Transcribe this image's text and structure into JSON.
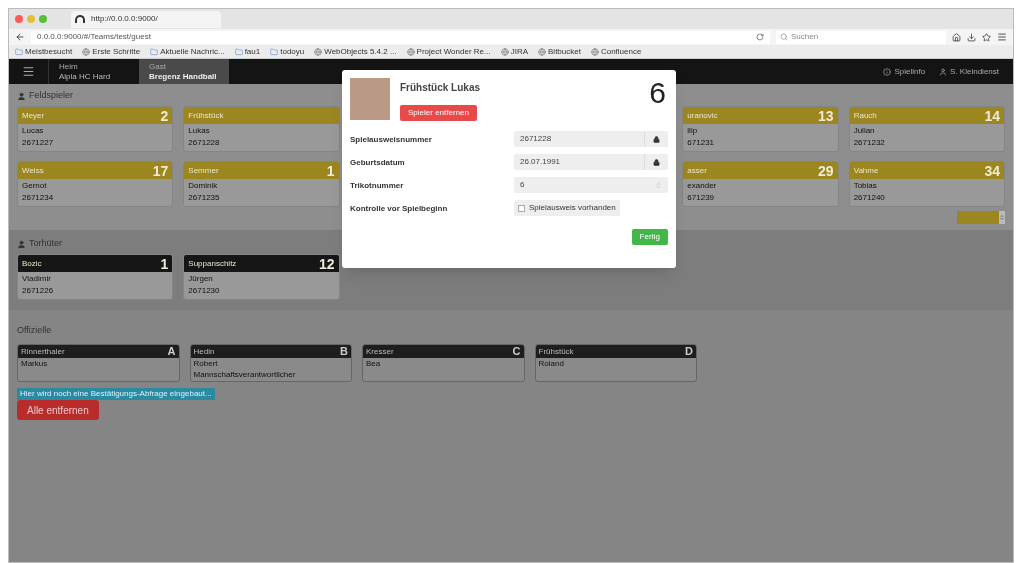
{
  "browser": {
    "tab_title": "http://0.0.0.0:9000/",
    "url": "0.0.0.0:9000/#/Teams/test/guest",
    "search_placeholder": "Suchen",
    "bookmarks": [
      {
        "label": "Meistbesucht",
        "kind": "folder"
      },
      {
        "label": "Erste Schritte",
        "kind": "page"
      },
      {
        "label": "Aktuelle Nachric...",
        "kind": "folder"
      },
      {
        "label": "fau1",
        "kind": "folder"
      },
      {
        "label": "todoyu",
        "kind": "folder"
      },
      {
        "label": "WebObjects 5.4.2 ...",
        "kind": "page"
      },
      {
        "label": "Project Wonder Re...",
        "kind": "page"
      },
      {
        "label": "JIRA",
        "kind": "page"
      },
      {
        "label": "Bitbucket",
        "kind": "page"
      },
      {
        "label": "Confluence",
        "kind": "page"
      }
    ]
  },
  "navbar": {
    "teams": [
      {
        "caption": "Heim",
        "name": "Alpla HC Hard",
        "selected": false
      },
      {
        "caption": "Gast",
        "name": "Bregenz Handball",
        "selected": true
      }
    ],
    "links": [
      {
        "label": "Spielinfo",
        "kind": "info"
      },
      {
        "label": "S. Kleindienst",
        "kind": "user"
      }
    ]
  },
  "field_players": {
    "title": "Feldspieler",
    "rows": [
      {
        "left": [
          {
            "last": "Meyer",
            "number": "2",
            "first": "Lucas",
            "id": "2671227"
          },
          {
            "last": "Frühstück",
            "first": "Lukas",
            "id": "2671228"
          }
        ],
        "right": [
          {
            "last": "uranovic",
            "number": "13",
            "first": "ilip",
            "id": "671231"
          },
          {
            "last": "Rauch",
            "number": "14",
            "first": "Julian",
            "id": "2671232"
          }
        ]
      },
      {
        "left": [
          {
            "last": "Weiss",
            "number": "17",
            "first": "Gernot",
            "id": "2671234"
          },
          {
            "last": "Semmer",
            "number": "1",
            "first": "Dominik",
            "id": "2671235"
          }
        ],
        "right": [
          {
            "last": "asser",
            "number": "29",
            "first": "exander",
            "id": "671239"
          },
          {
            "last": "Vahme",
            "number": "34",
            "first": "Tobias",
            "id": "2671240"
          }
        ]
      }
    ]
  },
  "goalkeepers": {
    "title": "Torhüter",
    "cards": [
      {
        "last": "Bozic",
        "number": "1",
        "first": "Vladimir",
        "id": "2671226"
      },
      {
        "last": "Suppanschitz",
        "number": "12",
        "first": "Jürgen",
        "id": "2671230"
      }
    ]
  },
  "officials": {
    "title": "Offizielle",
    "cards": [
      {
        "last": "Rinnerthaler",
        "letter": "A",
        "first": "Markus"
      },
      {
        "last": "Hedin",
        "letter": "B",
        "first": "Robert",
        "role": "Mannschaftsverantwortlicher"
      },
      {
        "last": "Kresser",
        "letter": "C",
        "first": "Bea"
      },
      {
        "last": "Frühstück",
        "letter": "D",
        "first": "Roland"
      }
    ]
  },
  "info_badge": "Hier wird noch eine Bestätigungs-Abfrage eingebaut...",
  "remove_all_button": "Alle entfernen",
  "modal": {
    "name": "Frühstück Lukas",
    "number": "6",
    "remove_button": "Spieler entfernen",
    "fields": [
      {
        "label": "Spielausweisnummer",
        "value": "2671228",
        "kind": "locked"
      },
      {
        "label": "Geburtsdatum",
        "value": "26.07.1991",
        "kind": "locked"
      },
      {
        "label": "Trikotnummer",
        "value": "6",
        "kind": "spinner"
      },
      {
        "label": "Kontrolle vor Spielbeginn",
        "value": "Spielausweis vorhanden",
        "kind": "checkbox",
        "checked": false
      }
    ],
    "done_button": "Fertig"
  }
}
